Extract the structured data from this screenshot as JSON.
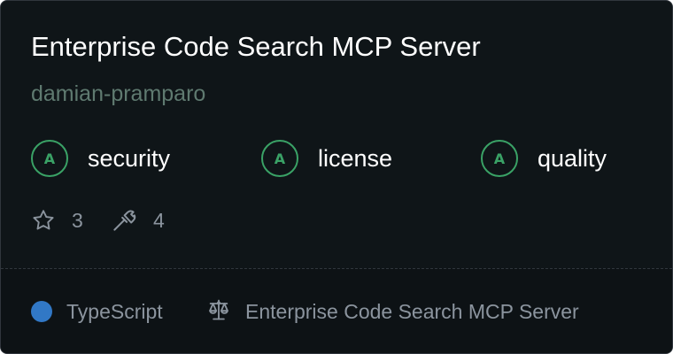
{
  "card": {
    "title": "Enterprise Code Search MCP Server",
    "author": "damian-pramparo"
  },
  "grades": [
    {
      "grade": "A",
      "label": "security"
    },
    {
      "grade": "A",
      "label": "license"
    },
    {
      "grade": "A",
      "label": "quality"
    }
  ],
  "stats": {
    "stars": "3",
    "tools": "4"
  },
  "footer": {
    "language": "TypeScript",
    "language_color": "#3178c6",
    "license_text": "Enterprise Code Search MCP Server"
  },
  "colors": {
    "grade_accent": "#3aa266"
  }
}
